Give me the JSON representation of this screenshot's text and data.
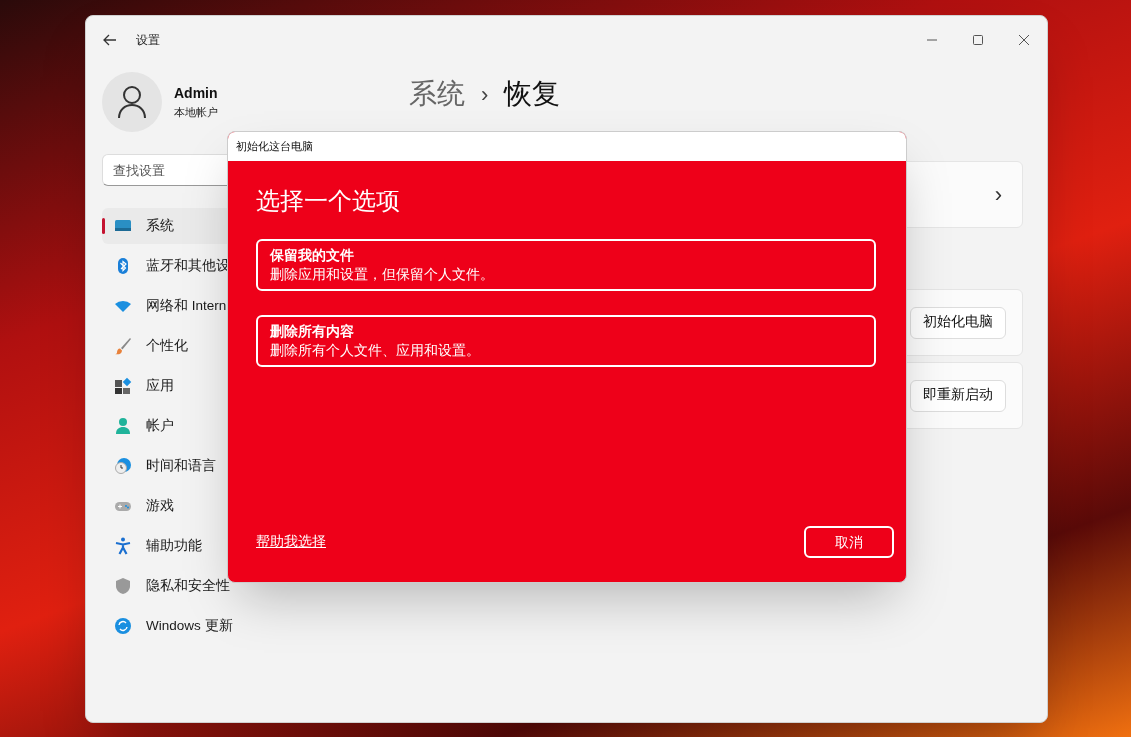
{
  "window": {
    "title": "设置"
  },
  "account": {
    "name": "Admin",
    "type": "本地帐户"
  },
  "search": {
    "placeholder": "查找设置"
  },
  "sidebar": {
    "items": [
      {
        "label": "系统",
        "kind": "system",
        "selected": true
      },
      {
        "label": "蓝牙和其他设",
        "kind": "bluetooth",
        "selected": false
      },
      {
        "label": "网络和 Intern",
        "kind": "wifi",
        "selected": false
      },
      {
        "label": "个性化",
        "kind": "brush",
        "selected": false
      },
      {
        "label": "应用",
        "kind": "apps",
        "selected": false
      },
      {
        "label": "帐户",
        "kind": "person",
        "selected": false
      },
      {
        "label": "时间和语言",
        "kind": "clock",
        "selected": false
      },
      {
        "label": "游戏",
        "kind": "gamepad",
        "selected": false
      },
      {
        "label": "辅助功能",
        "kind": "accessibility",
        "selected": false
      },
      {
        "label": "隐私和安全性",
        "kind": "shield",
        "selected": false
      },
      {
        "label": "Windows 更新",
        "kind": "update",
        "selected": false
      }
    ]
  },
  "breadcrumb": {
    "parent": "系统",
    "separator": "›",
    "current": "恢复"
  },
  "cards": [
    {
      "kind": "chevron",
      "button": "›"
    },
    {
      "kind": "button",
      "button": "初始化电脑"
    },
    {
      "kind": "button",
      "button": "即重新启动"
    }
  ],
  "dialog": {
    "title": "初始化这台电脑",
    "heading": "选择一个选项",
    "options": [
      {
        "title": "保留我的文件",
        "description": "删除应用和设置，但保留个人文件。"
      },
      {
        "title": "删除所有内容",
        "description": "删除所有个人文件、应用和设置。"
      }
    ],
    "help_link": "帮助我选择",
    "cancel": "取消"
  }
}
